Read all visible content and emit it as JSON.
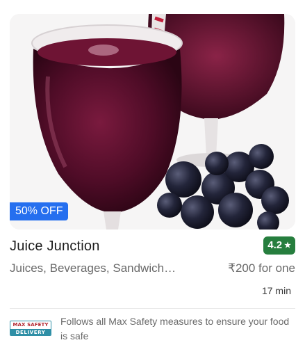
{
  "card": {
    "offer_label": "50% OFF",
    "restaurant_name": "Juice Junction",
    "rating": "4.2",
    "rating_star": "★",
    "cuisines": "Juices, Beverages, Sandwiches",
    "price": "₹200 for one",
    "delivery_time": "17 min",
    "safety_logo_top": "MAX SAFETY",
    "safety_logo_bottom": "DELIVERY",
    "safety_text": "Follows all Max Safety measures to ensure your food is safe",
    "image_subject": "grape juice in wine glasses with grapes"
  },
  "colors": {
    "offer_badge": "#256fef",
    "rating_badge": "#267e3e",
    "safety_accent": "#2f8fa6"
  }
}
